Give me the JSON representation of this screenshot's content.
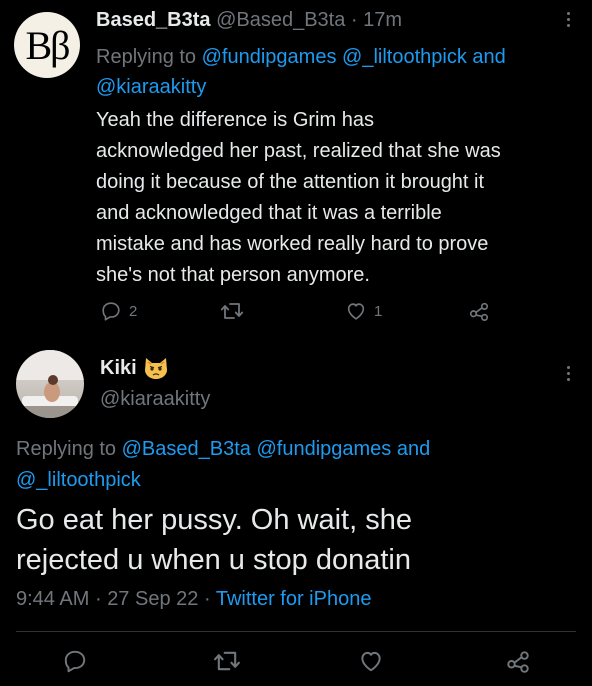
{
  "tweet1": {
    "avatar_text": "Bβ",
    "display_name": "Based_B3ta",
    "handle": "@Based_B3ta",
    "separator": "·",
    "time": "17m",
    "replying_prefix": "Replying to",
    "replying_to_1": "@fundipgames",
    "replying_to_2": "@_liltoothpick",
    "replying_and": "and",
    "replying_to_3": "@kiaraakitty",
    "text_lines": [
      "Yeah the difference is Grim has",
      "acknowledged her past, realized that she was",
      "doing it because of the attention it brought it",
      "and acknowledged that it was a terrible",
      "mistake and has worked really hard to prove",
      "she's not that person anymore."
    ],
    "reply_count": "2",
    "like_count": "1"
  },
  "tweet2": {
    "display_name": "Kiki",
    "emoji": "😾",
    "handle": "@kiaraakitty",
    "replying_prefix": "Replying to",
    "replying_to_1": "@Based_B3ta",
    "replying_to_2": "@fundipgames",
    "replying_and": "and",
    "replying_to_3": "@_liltoothpick",
    "text_lines": [
      "Go eat her pussy. Oh wait, she",
      "rejected u when u stop donatin"
    ],
    "time": "9:44 AM",
    "date": "27 Sep 22",
    "separator": "·",
    "source": "Twitter for iPhone"
  },
  "colors": {
    "background": "#000000",
    "text": "#e7e9ea",
    "muted": "#71767b",
    "link": "#1d9bf0",
    "divider": "#2f3336"
  },
  "icons": [
    "reply-icon",
    "retweet-icon",
    "like-icon",
    "share-icon",
    "more-icon"
  ]
}
